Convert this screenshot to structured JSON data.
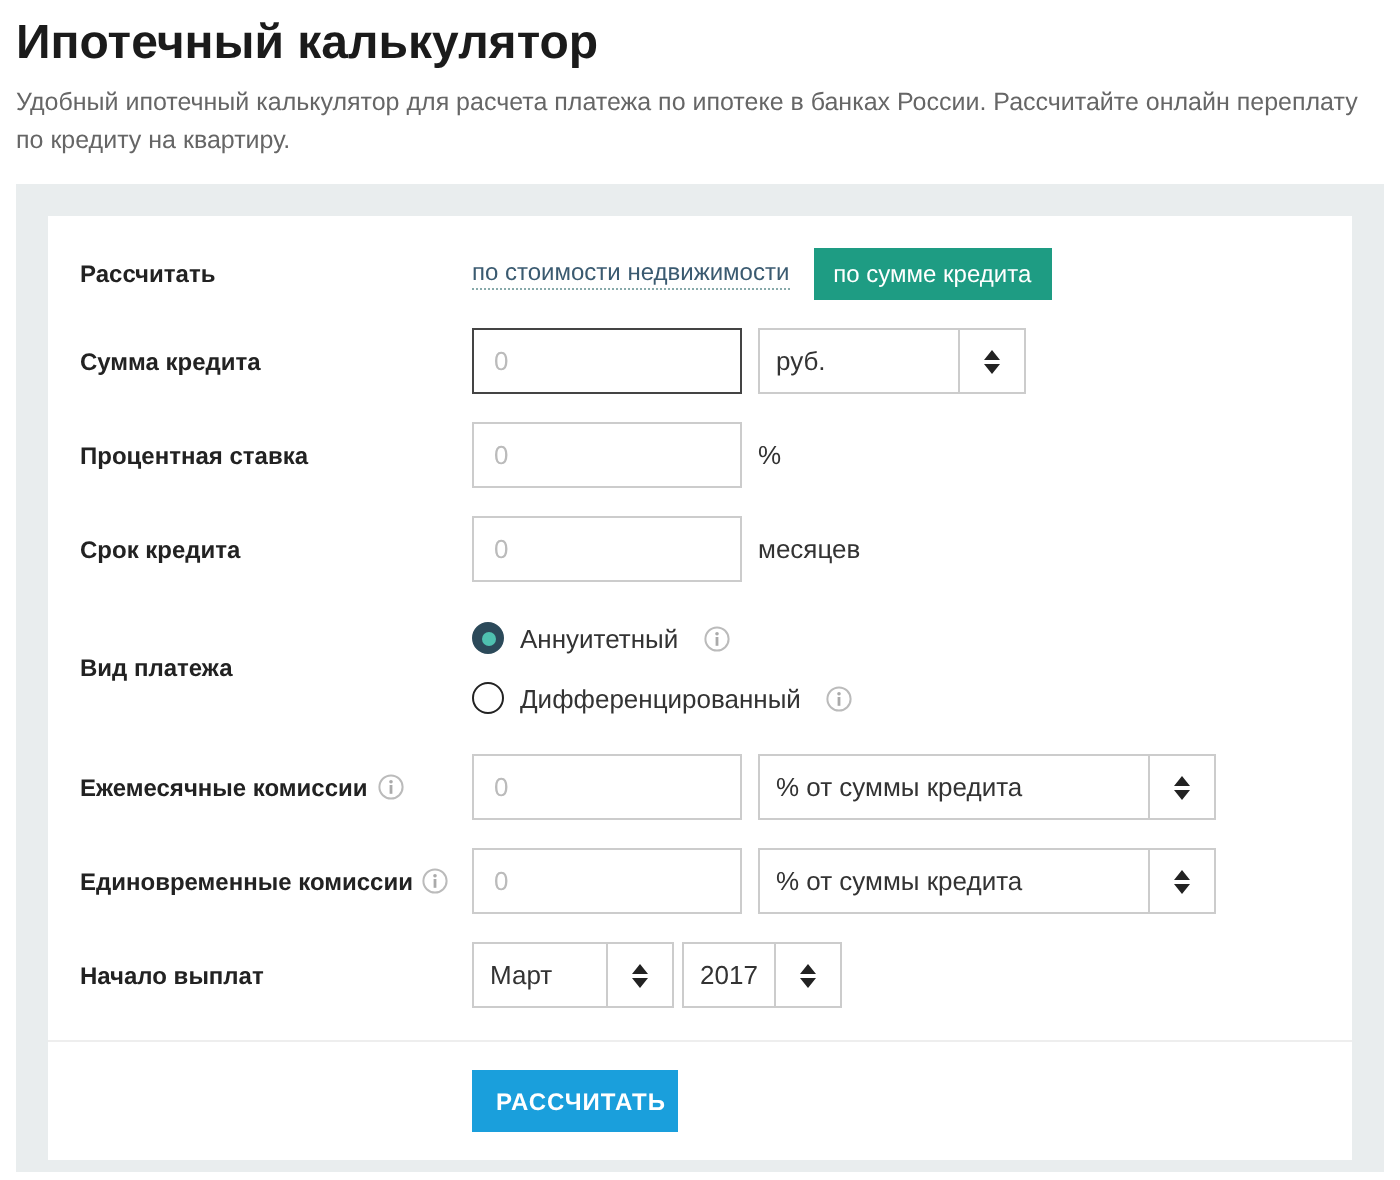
{
  "title": "Ипотечный калькулятор",
  "description": "Удобный ипотечный калькулятор для расчета платежа по ипотеке в банках России. Рассчитайте онлайн переплату по кредиту на квартиру.",
  "form": {
    "mode": {
      "label": "Рассчитать",
      "options": [
        {
          "label": "по стоимости недвижимости",
          "selected": false
        },
        {
          "label": "по сумме кредита",
          "selected": true
        }
      ]
    },
    "rows": [
      {
        "kind": "input-select",
        "label": "Сумма кредита",
        "info": false,
        "placeholder": "0",
        "focused": true,
        "select": "руб."
      },
      {
        "kind": "input-unit",
        "label": "Процентная ставка",
        "info": false,
        "placeholder": "0",
        "focused": false,
        "unit": "%"
      },
      {
        "kind": "input-unit",
        "label": "Срок кредита",
        "info": false,
        "placeholder": "0",
        "focused": false,
        "unit": "месяцев"
      },
      {
        "kind": "radio",
        "label": "Вид платежа",
        "info": false,
        "options": [
          {
            "label": "Аннуитетный",
            "selected": true,
            "info": true
          },
          {
            "label": "Дифференцированный",
            "selected": false,
            "info": true
          }
        ]
      },
      {
        "kind": "input-select",
        "label": "Ежемесячные комиссии",
        "info": true,
        "placeholder": "0",
        "focused": false,
        "select": "% от суммы кредита"
      },
      {
        "kind": "input-select",
        "label": "Единовременные комиссии",
        "info": true,
        "placeholder": "0",
        "focused": false,
        "select": "% от суммы кредита"
      },
      {
        "kind": "date",
        "label": "Начало выплат",
        "info": false,
        "selects": [
          "Март",
          "2017"
        ]
      }
    ],
    "submit": "РАССЧИТАТЬ"
  }
}
